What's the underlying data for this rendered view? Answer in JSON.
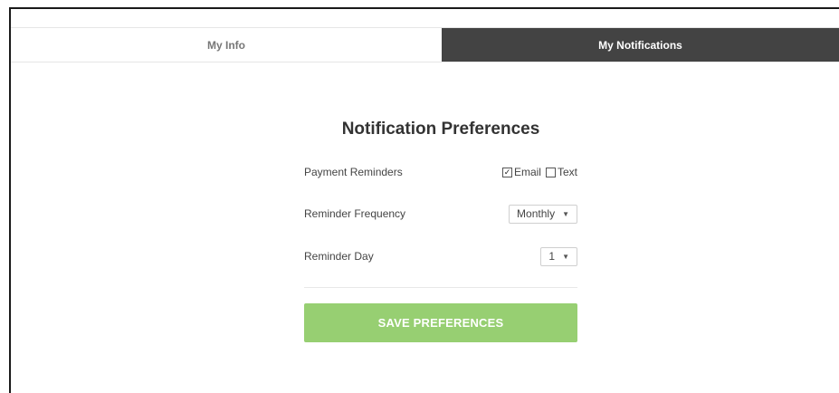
{
  "tabs": [
    {
      "label": "My Info",
      "active": false
    },
    {
      "label": "My Notifications",
      "active": true
    }
  ],
  "panel": {
    "title": "Notification Preferences",
    "payment_reminders": {
      "label": "Payment Reminders",
      "email": {
        "label": "Email",
        "checked": true,
        "mark": "✓"
      },
      "text": {
        "label": "Text",
        "checked": false
      }
    },
    "reminder_frequency": {
      "label": "Reminder Frequency",
      "value": "Monthly"
    },
    "reminder_day": {
      "label": "Reminder Day",
      "value": "1"
    },
    "save_label": "SAVE PREFERENCES"
  },
  "colors": {
    "active_tab_bg": "#434343",
    "save_button_bg": "#97cf72"
  },
  "icons": {
    "dropdown": "▼"
  }
}
